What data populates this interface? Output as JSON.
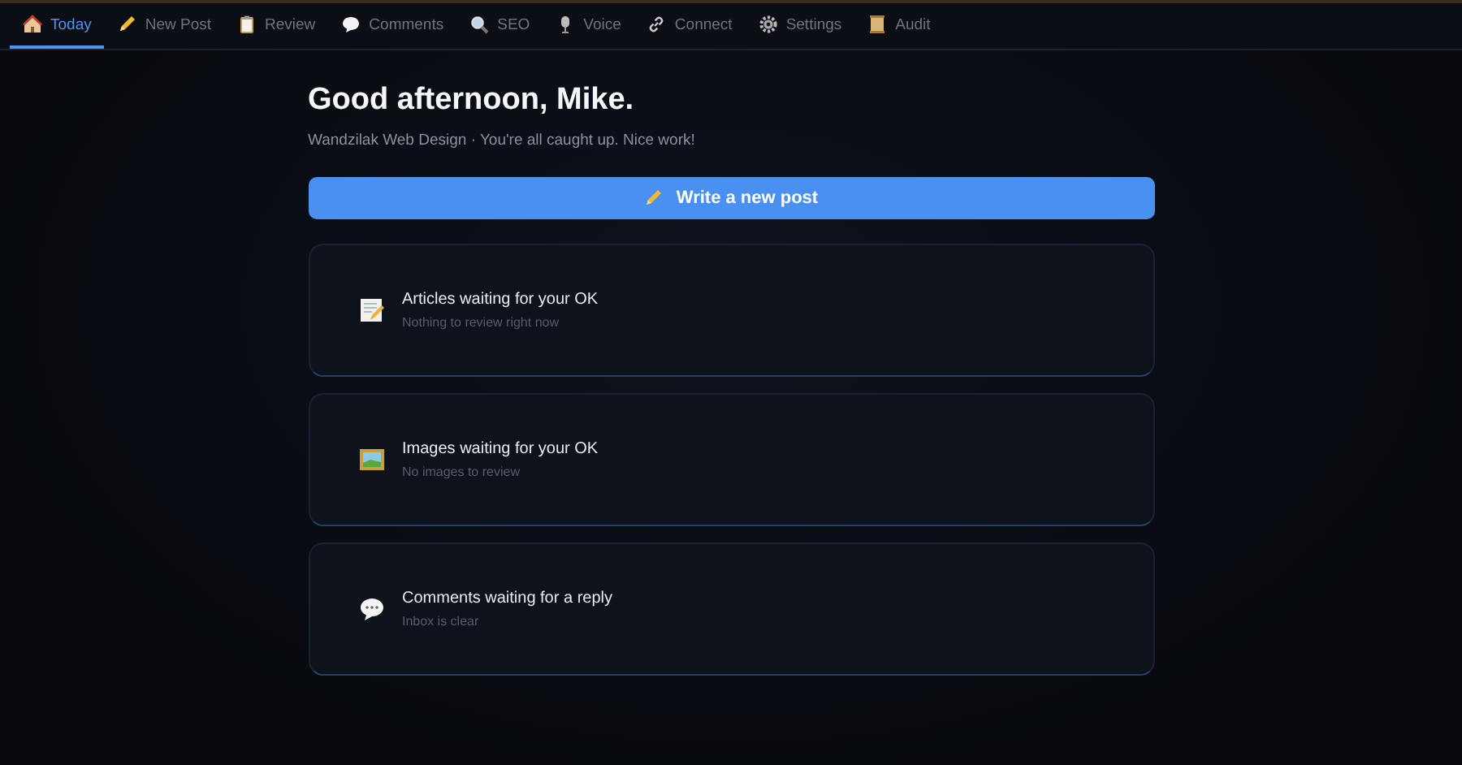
{
  "tabs": [
    {
      "label": "Today",
      "selected": true
    },
    {
      "label": "New Post",
      "selected": false
    },
    {
      "label": "Review",
      "selected": false
    },
    {
      "label": "Comments",
      "selected": false
    },
    {
      "label": "SEO",
      "selected": false
    },
    {
      "label": "Voice",
      "selected": false
    },
    {
      "label": "Connect",
      "selected": false
    },
    {
      "label": "Settings",
      "selected": false
    },
    {
      "label": "Audit",
      "selected": false
    }
  ],
  "greeting": "Good afternoon, Mike.",
  "subtitle": "Wandzilak Web Design · You're all caught up. Nice work!",
  "primary_button": {
    "label": "Write a new post"
  },
  "cards": [
    {
      "title": "Articles waiting for your OK",
      "status": "Nothing to review right now"
    },
    {
      "title": "Images waiting for your OK",
      "status": "No images to review"
    },
    {
      "title": "Comments waiting for a reply",
      "status": "Inbox is clear"
    }
  ]
}
